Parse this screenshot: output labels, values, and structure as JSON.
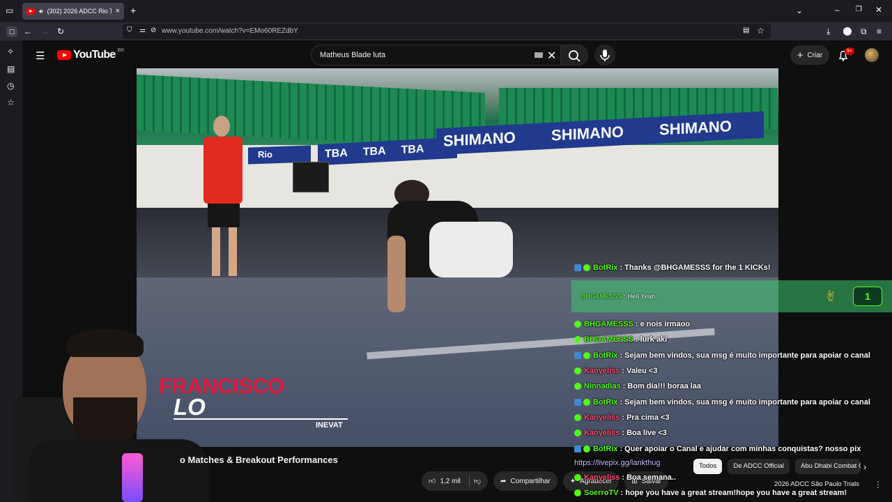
{
  "browser": {
    "tab_title": "(302) 2026 ADCC Rio Trials",
    "url": "www.youtube.com/watch?v=EMo60REZdbY"
  },
  "youtube": {
    "logo_text": "YouTube",
    "country_code": "BR",
    "search_value": "Matheus Blade luta",
    "create_label": "Criar",
    "notifications": "9+"
  },
  "video": {
    "banners": [
      "TBA",
      "TBA",
      "TBA",
      "SHIMANO",
      "SHIMANO",
      "SHIMANO"
    ],
    "rio_sign": "Rio",
    "lower_third_name_1": "FRANCISCO",
    "lower_third_name_2": "LO",
    "lower_third_team": "INEVAT",
    "title": "o Matches & Breakout Performances"
  },
  "actions": {
    "likes": "1,2 mil",
    "share": "Compartilhar",
    "thanks": "Agradecer",
    "save": "Salvar"
  },
  "chips": [
    "Todos",
    "De ADCC Official",
    "Abu Dhabi Combat C"
  ],
  "related_title": "2026 ADCC São Paulo Trials",
  "chat": [
    {
      "user": "BotRix",
      "userColor": "#53fc18",
      "kick": true,
      "text": ": Thanks @BHGAMESSS for the 1 KICKs!"
    },
    {
      "user": "BHGAMESSS",
      "userColor": "#53fc18",
      "kick": false,
      "text": ": Hell Yeah"
    },
    {
      "user": "BHGAMESSS",
      "userColor": "#53fc18",
      "kick": false,
      "text": ": e nois irmaoo"
    },
    {
      "user": "BHGAMESSS",
      "userColor": "#53fc18",
      "kick": false,
      "text": ": lurk aki"
    },
    {
      "user": "BotRix",
      "userColor": "#53fc18",
      "kick": true,
      "text": ": Sejam bem vindos, sua msg é muito importante para apoiar o canal"
    },
    {
      "user": "Kanyeliss",
      "userColor": "#ff4d6d",
      "kick": false,
      "text": ": Valeu <3"
    },
    {
      "user": "Ninnadias",
      "userColor": "#53fc18",
      "kick": false,
      "text": ": Bom dia!!! boraa laa"
    },
    {
      "user": "BotRix",
      "userColor": "#53fc18",
      "kick": true,
      "text": ": Sejam bem vindos, sua msg é muito importante para apoiar o canal"
    },
    {
      "user": "Kanyeliss",
      "userColor": "#ff4d6d",
      "kick": false,
      "text": ": Pra cima <3"
    },
    {
      "user": "Kanyeliss",
      "userColor": "#ff4d6d",
      "kick": false,
      "text": ": Boa live <3"
    },
    {
      "user": "BotRix",
      "userColor": "#53fc18",
      "kick": true,
      "text": ": Quer apoiar o Canal e ajudar com minhas conquistas? nosso pix"
    },
    {
      "user": "",
      "userColor": "#ffffff",
      "kick": false,
      "text": "https://livepix.gg/lankthug"
    },
    {
      "user": "Kanyeliss",
      "userColor": "#ff4d6d",
      "kick": false,
      "text": ": Boa semana.."
    },
    {
      "user": "SoerroTV",
      "userColor": "#53fc18",
      "kick": false,
      "text": ": hope you have a great stream!hope you have a great stream!"
    }
  ],
  "kick_highlight_count": "1",
  "colors": {
    "youtube_red": "#ff0000",
    "kick_green": "#53fc18",
    "bg": "#0f0f0f"
  }
}
